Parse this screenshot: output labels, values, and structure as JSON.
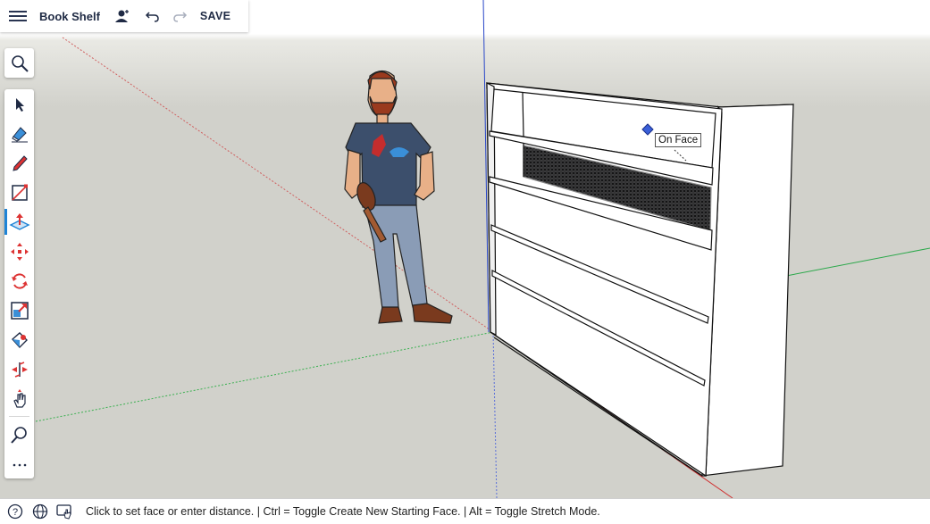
{
  "app": {
    "title": "Book Shelf",
    "save_label": "SAVE"
  },
  "toolbar_icons": [
    "menu-icon",
    "user-icon",
    "undo-icon",
    "redo-icon"
  ],
  "tools": [
    {
      "name": "search-icon"
    },
    {
      "name": "select-icon"
    },
    {
      "name": "eraser-icon"
    },
    {
      "name": "pencil-icon"
    },
    {
      "name": "rectangle-icon"
    },
    {
      "name": "push-pull-icon",
      "active": true
    },
    {
      "name": "move-icon"
    },
    {
      "name": "rotate-icon"
    },
    {
      "name": "scale-icon"
    },
    {
      "name": "paint-bucket-icon"
    },
    {
      "name": "section-plane-icon"
    },
    {
      "name": "pan-icon"
    },
    {
      "name": "zoom-icon"
    },
    {
      "name": "more-icon"
    }
  ],
  "inference_tooltip": "On Face",
  "status": {
    "message": "Click to set face or enter distance. | Ctrl = Toggle Create New Starting Face. | Alt = Toggle Stretch Mode."
  },
  "colors": {
    "accent": "#1f84d6",
    "active_tool": "#1f84d6",
    "axis_red": "#d03030",
    "axis_green": "#2aa84a",
    "axis_blue": "#2846c8"
  }
}
